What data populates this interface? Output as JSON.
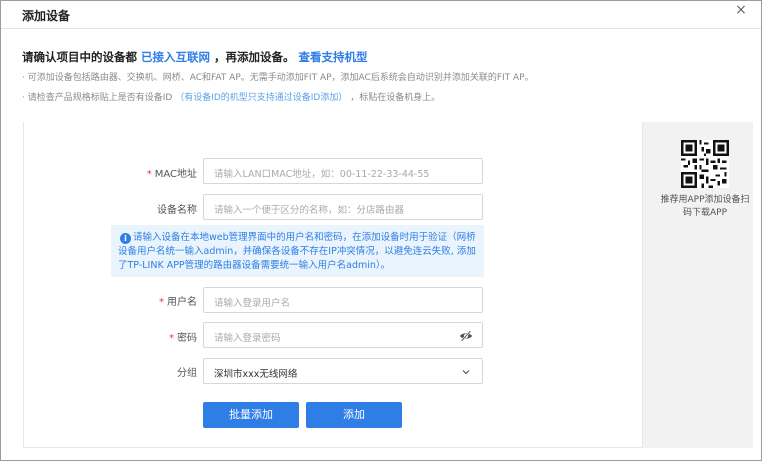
{
  "dialog": {
    "title": "添加设备",
    "close_label": "×"
  },
  "notice": {
    "head_prefix": "请确认项目中的设备都",
    "head_link1": "已接入互联网",
    "head_middle": "，再添加设备。",
    "head_link2": "查看支持机型",
    "note1": "· 可添加设备包括路由器、交换机、网桥、AC和FAT AP。无需手动添加FIT AP，添加AC后系统会自动识别并添加关联的FIT AP。",
    "note2_prefix": "· 请检查产品规格标贴上是否有设备ID",
    "note2_blue": "（有设备ID的机型只支持通过设备ID添加）",
    "note2_suffix": "，标贴在设备机身上。"
  },
  "form": {
    "mac_label": "MAC地址",
    "mac_placeholder": "请输入LAN口MAC地址，如：00-11-22-33-44-55",
    "name_label": "设备名称",
    "name_placeholder": "请输入一个便于区分的名称，如：分店路由器",
    "info_text": "请输入设备在本地web管理界面中的用户名和密码，在添加设备时用于验证（网桥设备用户名统一输入admin，并确保各设备不存在IP冲突情况，以避免连云失败, 添加了TP-LINK APP管理的路由器设备需要统一输入用户名admin）。",
    "username_label": "用户名",
    "username_placeholder": "请输入登录用户名",
    "password_label": "密码",
    "password_placeholder": "请输入登录密码",
    "group_label": "分组",
    "group_value": "深圳市xxx无线网络",
    "required_mark": "*"
  },
  "buttons": {
    "batch_add": "批量添加",
    "add": "添加"
  },
  "side": {
    "qr_caption": "推荐用APP添加设备扫码下载APP"
  },
  "colors": {
    "accent": "#2e7ee6",
    "info_bg": "#e9f4fd",
    "required": "#e53935"
  },
  "icons": [
    "close-icon",
    "info-icon",
    "eye-off-icon",
    "chevron-down-icon",
    "qr-code-icon"
  ]
}
